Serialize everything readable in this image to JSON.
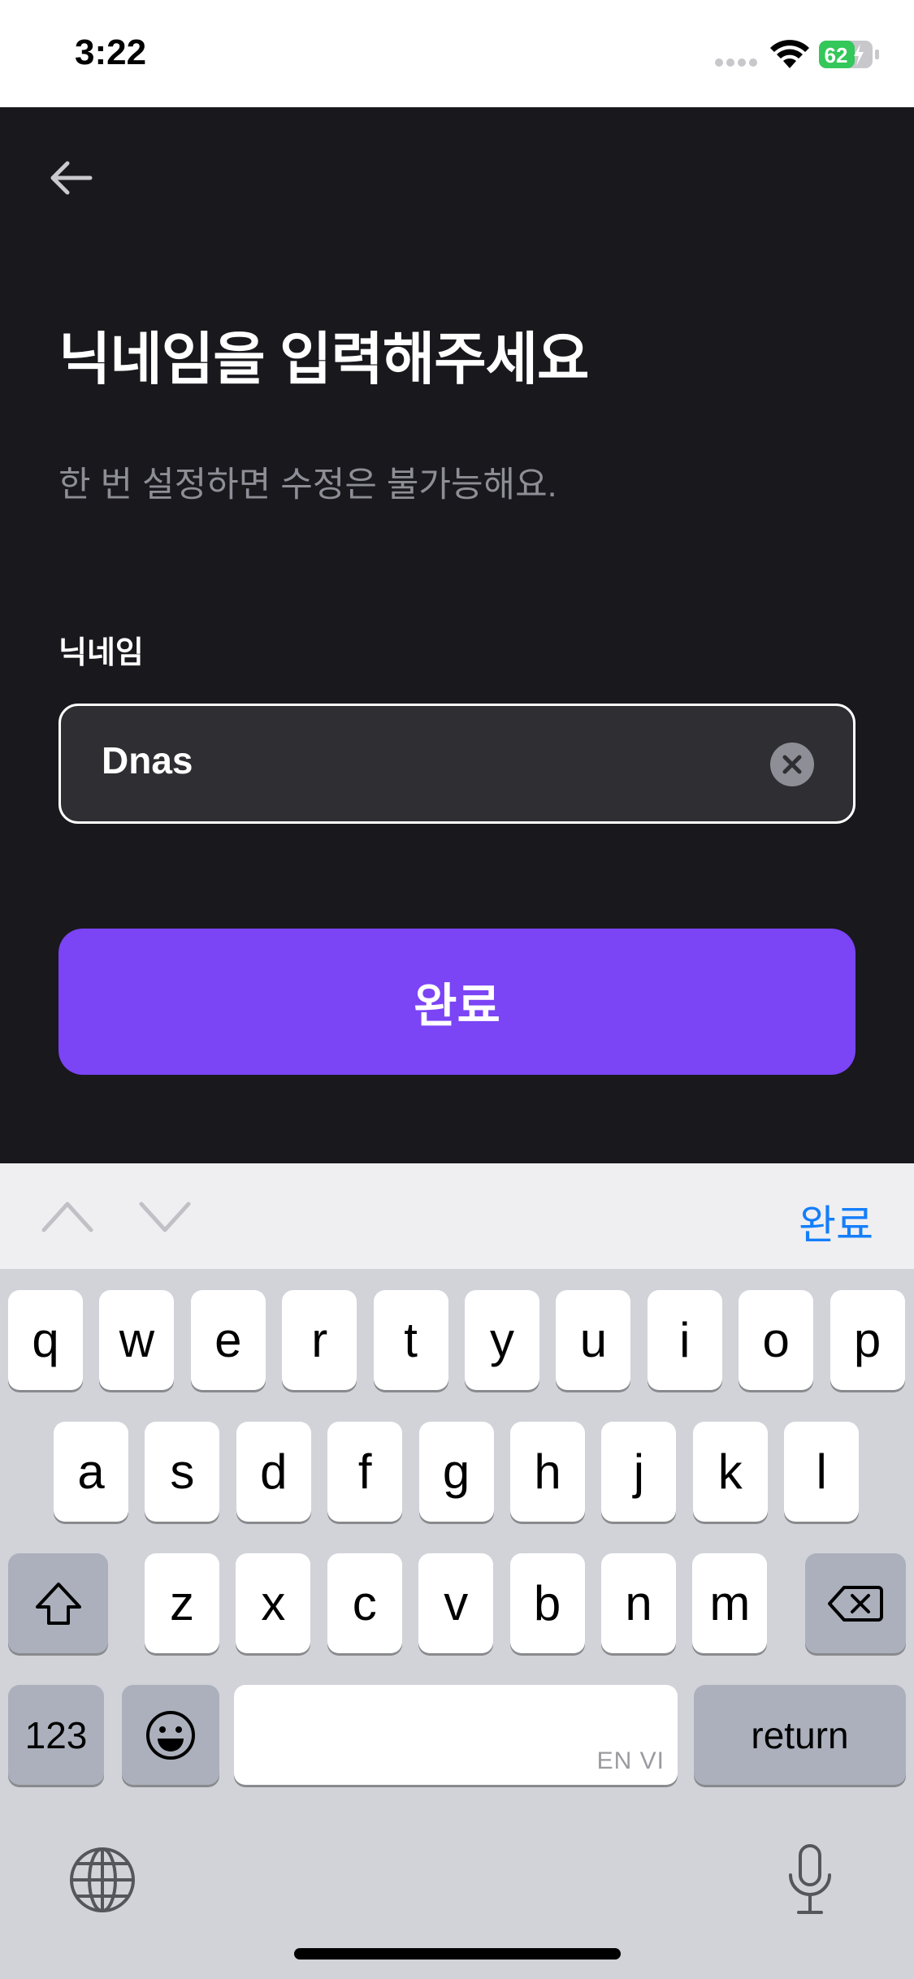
{
  "status_bar": {
    "time": "3:22",
    "battery_level": "62"
  },
  "header": {
    "back_icon": "arrow-left-icon"
  },
  "main": {
    "title": "닉네임을 입력해주세요",
    "subtitle": "한 번 설정하면 수정은 불가능해요.",
    "field_label": "닉네임",
    "input_value": "Dnas",
    "clear_icon": "clear-circle-icon",
    "complete_button_label": "완료",
    "accent_color": "#7b44f5"
  },
  "accessory": {
    "done_label": "완료",
    "done_color": "#157efb"
  },
  "keyboard": {
    "row1": [
      "q",
      "w",
      "e",
      "r",
      "t",
      "y",
      "u",
      "i",
      "o",
      "p"
    ],
    "row2": [
      "a",
      "s",
      "d",
      "f",
      "g",
      "h",
      "j",
      "k",
      "l"
    ],
    "row3": [
      "z",
      "x",
      "c",
      "v",
      "b",
      "n",
      "m"
    ],
    "numbers_label": "123",
    "return_label": "return",
    "space_lang": "EN VI"
  }
}
